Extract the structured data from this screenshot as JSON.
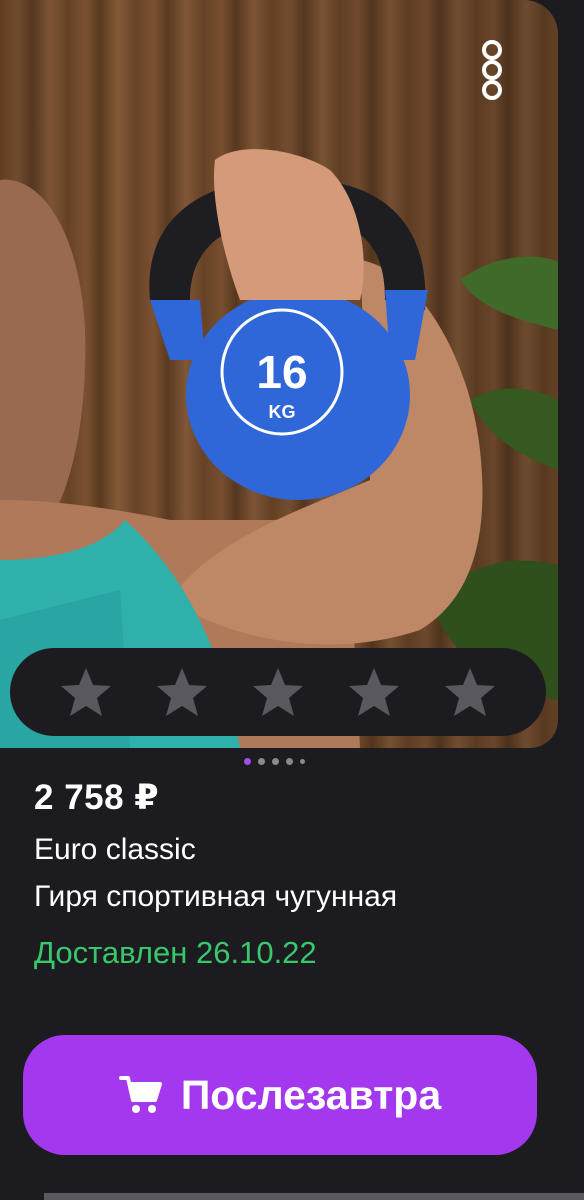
{
  "product": {
    "price": "2 758 ₽",
    "brand": "Euro classic",
    "name": "Гиря спортивная чугунная",
    "delivery_status": "Доставлен 26.10.22"
  },
  "image": {
    "weight_value": "16",
    "weight_unit": "KG",
    "carousel_total": 5,
    "carousel_active": 1
  },
  "rating": {
    "stars_total": 5,
    "stars_filled": 0
  },
  "cart_button": {
    "label": "Послезавтра",
    "icon": "cart-icon"
  },
  "colors": {
    "background": "#1c1b20",
    "accent": "#a438ee",
    "delivered": "#37c86b",
    "star_empty": "#59585f"
  }
}
